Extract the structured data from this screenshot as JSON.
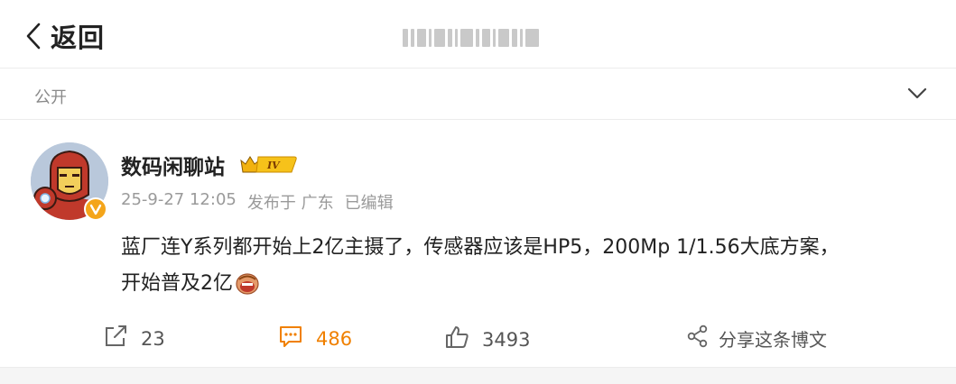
{
  "header": {
    "back_label": "返回",
    "back_icon": "chevron-left-icon"
  },
  "visibility": {
    "label": "公开",
    "chevron_icon": "chevron-down-icon"
  },
  "post": {
    "author": "数码闲聊站",
    "author_level": "IV",
    "timestamp": "25-9-27 12:05",
    "published_from": "发布于 广东",
    "edited": "已编辑",
    "text_line1": "蓝厂连Y系列都开始上2亿主摄了，传感器应该是HP5，200Mp 1/1.56大底方案，",
    "text_line2": "开始普及2亿"
  },
  "actions": {
    "repost_count": "23",
    "comment_count": "486",
    "like_count": "3493",
    "share_label": "分享这条博文"
  },
  "colors": {
    "accent_comment": "#f08000",
    "verified_badge": "#f4a51a"
  }
}
